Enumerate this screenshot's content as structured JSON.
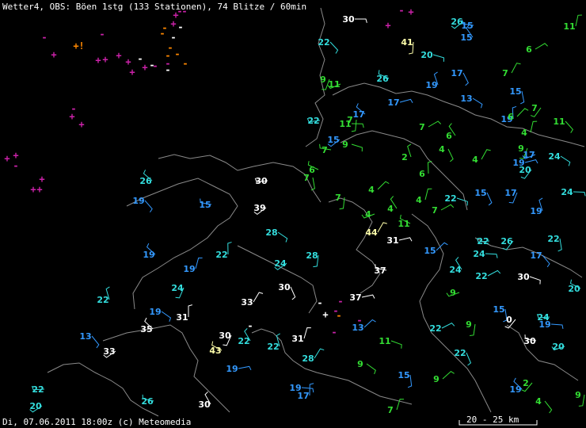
{
  "header": "Wetter4, OBS: Böen 1stg (133 Stationen), 74 Blitze / 60min",
  "footer": "Di, 07.06.2011 18:00z (c) Meteomedia",
  "scale_label": "20 - 25 km",
  "colors": {
    "white": "#ffffff",
    "green": "#33dd33",
    "blue": "#3399ff",
    "cyan": "#33dddd",
    "yellow": "#ffffaa",
    "magenta": "#cc22aa",
    "orange": "#ff8800"
  },
  "stations": [
    {
      "v": "30",
      "c": "white"
    },
    {
      "v": "22",
      "c": "cyan"
    },
    {
      "v": "41",
      "c": "yellow"
    },
    {
      "v": "26",
      "c": "cyan"
    },
    {
      "v": "15",
      "c": "blue"
    },
    {
      "v": "15",
      "c": "blue"
    },
    {
      "v": "11",
      "c": "green"
    },
    {
      "v": "6",
      "c": "green"
    },
    {
      "v": "20",
      "c": "cyan"
    },
    {
      "v": "17",
      "c": "blue"
    },
    {
      "v": "9",
      "c": "green"
    },
    {
      "v": "11",
      "c": "green"
    },
    {
      "v": "26",
      "c": "cyan"
    },
    {
      "v": "19",
      "c": "blue"
    },
    {
      "v": "7",
      "c": "green"
    },
    {
      "v": "17",
      "c": "blue"
    },
    {
      "v": "13",
      "c": "blue"
    },
    {
      "v": "15",
      "c": "blue"
    },
    {
      "v": "7",
      "c": "green"
    },
    {
      "v": "22",
      "c": "cyan"
    },
    {
      "v": "17",
      "c": "blue"
    },
    {
      "v": "19",
      "c": "blue"
    },
    {
      "v": "6",
      "c": "green"
    },
    {
      "v": "11",
      "c": "green"
    },
    {
      "v": "11",
      "c": "green"
    },
    {
      "v": "7",
      "c": "green"
    },
    {
      "v": "15",
      "c": "blue"
    },
    {
      "v": "7",
      "c": "green"
    },
    {
      "v": "6",
      "c": "green"
    },
    {
      "v": "4",
      "c": "green"
    },
    {
      "v": "7",
      "c": "green"
    },
    {
      "v": "9",
      "c": "green"
    },
    {
      "v": "4",
      "c": "green"
    },
    {
      "v": "9",
      "c": "green"
    },
    {
      "v": "17",
      "c": "blue"
    },
    {
      "v": "6",
      "c": "green"
    },
    {
      "v": "2",
      "c": "green"
    },
    {
      "v": "4",
      "c": "green"
    },
    {
      "v": "19",
      "c": "blue"
    },
    {
      "v": "24",
      "c": "cyan"
    },
    {
      "v": "7",
      "c": "green"
    },
    {
      "v": "20",
      "c": "cyan"
    },
    {
      "v": "30",
      "c": "white"
    },
    {
      "v": "26",
      "c": "cyan"
    },
    {
      "v": "6",
      "c": "green"
    },
    {
      "v": "4",
      "c": "green"
    },
    {
      "v": "24",
      "c": "cyan"
    },
    {
      "v": "19",
      "c": "blue"
    },
    {
      "v": "7",
      "c": "green"
    },
    {
      "v": "39",
      "c": "white"
    },
    {
      "v": "15",
      "c": "blue"
    },
    {
      "v": "4",
      "c": "green"
    },
    {
      "v": "4",
      "c": "green"
    },
    {
      "v": "7",
      "c": "green"
    },
    {
      "v": "22",
      "c": "cyan"
    },
    {
      "v": "15",
      "c": "blue"
    },
    {
      "v": "17",
      "c": "blue"
    },
    {
      "v": "4",
      "c": "green"
    },
    {
      "v": "11",
      "c": "green"
    },
    {
      "v": "19",
      "c": "blue"
    },
    {
      "v": "44",
      "c": "yellow"
    },
    {
      "v": "31",
      "c": "white"
    },
    {
      "v": "28",
      "c": "cyan"
    },
    {
      "v": "22",
      "c": "cyan"
    },
    {
      "v": "26",
      "c": "cyan"
    },
    {
      "v": "22",
      "c": "cyan"
    },
    {
      "v": "19",
      "c": "blue"
    },
    {
      "v": "22",
      "c": "cyan"
    },
    {
      "v": "15",
      "c": "blue"
    },
    {
      "v": "24",
      "c": "cyan"
    },
    {
      "v": "17",
      "c": "blue"
    },
    {
      "v": "28",
      "c": "cyan"
    },
    {
      "v": "24",
      "c": "cyan"
    },
    {
      "v": "37",
      "c": "white"
    },
    {
      "v": "24",
      "c": "cyan"
    },
    {
      "v": "19",
      "c": "blue"
    },
    {
      "v": "22",
      "c": "cyan"
    },
    {
      "v": "30",
      "c": "white"
    },
    {
      "v": "30",
      "c": "white"
    },
    {
      "v": "24",
      "c": "cyan"
    },
    {
      "v": "9",
      "c": "green"
    },
    {
      "v": "20",
      "c": "cyan"
    },
    {
      "v": "22",
      "c": "cyan"
    },
    {
      "v": "33",
      "c": "white"
    },
    {
      "v": "37",
      "c": "white"
    },
    {
      "v": "19",
      "c": "blue"
    },
    {
      "v": "15",
      "c": "blue"
    },
    {
      "v": "0",
      "c": "white"
    },
    {
      "v": "24",
      "c": "cyan"
    },
    {
      "v": "35",
      "c": "white"
    },
    {
      "v": "31",
      "c": "white"
    },
    {
      "v": "13",
      "c": "blue"
    },
    {
      "v": "19",
      "c": "blue"
    },
    {
      "v": "13",
      "c": "blue"
    },
    {
      "v": "9",
      "c": "green"
    },
    {
      "v": "33",
      "c": "white"
    },
    {
      "v": "30",
      "c": "white"
    },
    {
      "v": "22",
      "c": "cyan"
    },
    {
      "v": "31",
      "c": "white"
    },
    {
      "v": "22",
      "c": "cyan"
    },
    {
      "v": "11",
      "c": "green"
    },
    {
      "v": "22",
      "c": "cyan"
    },
    {
      "v": "30",
      "c": "white"
    },
    {
      "v": "20",
      "c": "cyan"
    },
    {
      "v": "43",
      "c": "yellow"
    },
    {
      "v": "22",
      "c": "cyan"
    },
    {
      "v": "28",
      "c": "cyan"
    },
    {
      "v": "19",
      "c": "blue"
    },
    {
      "v": "9",
      "c": "green"
    },
    {
      "v": "15",
      "c": "blue"
    },
    {
      "v": "2",
      "c": "green"
    },
    {
      "v": "22",
      "c": "cyan"
    },
    {
      "v": "19",
      "c": "blue"
    },
    {
      "v": "17",
      "c": "blue"
    },
    {
      "v": "9",
      "c": "green"
    },
    {
      "v": "19",
      "c": "blue"
    },
    {
      "v": "4",
      "c": "green"
    },
    {
      "v": "9",
      "c": "green"
    },
    {
      "v": "20",
      "c": "cyan"
    },
    {
      "v": "26",
      "c": "cyan"
    },
    {
      "v": "30",
      "c": "white"
    },
    {
      "v": "7",
      "c": "green"
    }
  ]
}
